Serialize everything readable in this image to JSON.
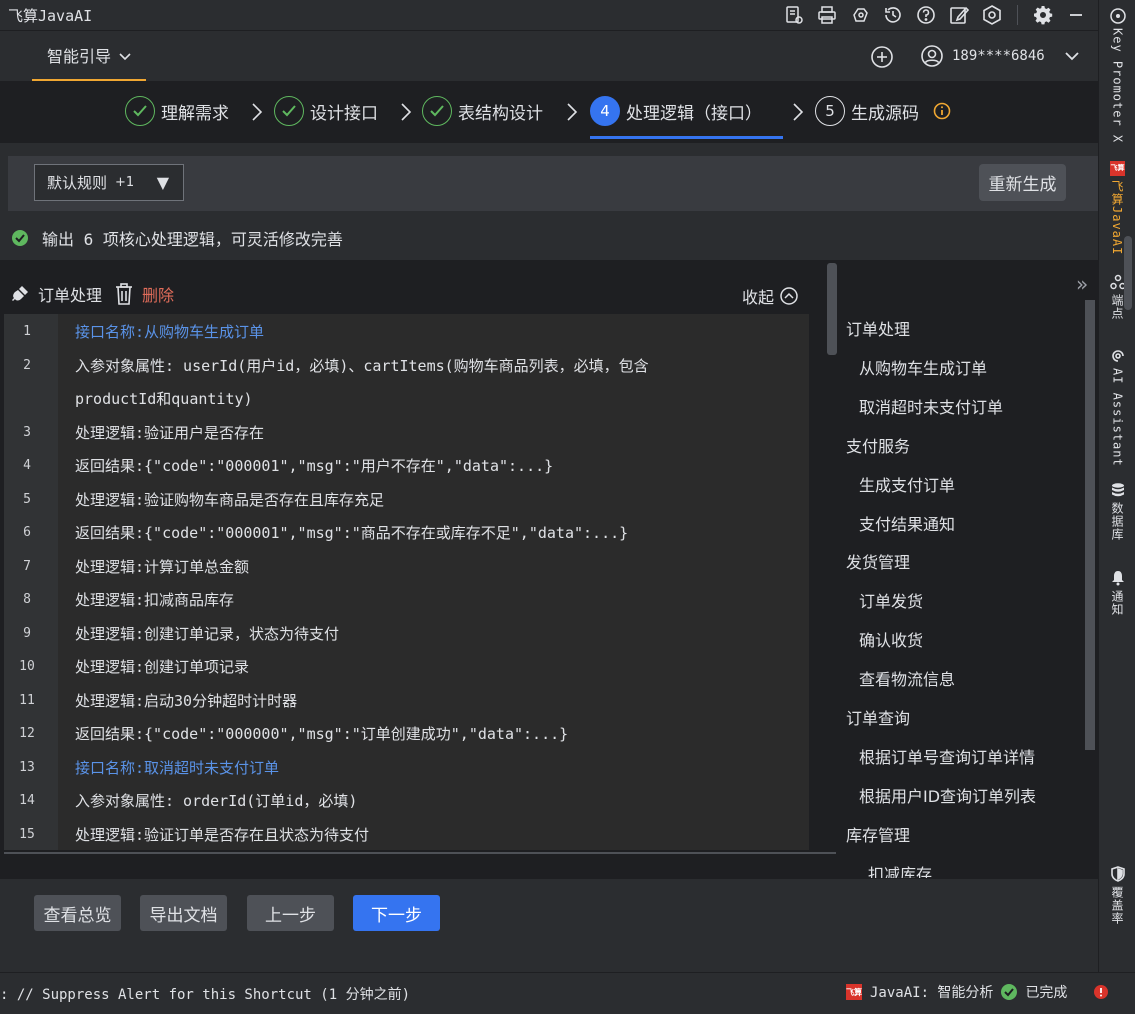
{
  "window": {
    "title": "飞算JavaAI"
  },
  "header": {
    "guide_tab": "智能引导",
    "user_phone": "189****6846"
  },
  "steps": [
    {
      "label": "理解需求",
      "num": "",
      "state": "done"
    },
    {
      "label": "设计接口",
      "num": "",
      "state": "done"
    },
    {
      "label": "表结构设计",
      "num": "",
      "state": "done"
    },
    {
      "label": "处理逻辑（接口）",
      "num": "4",
      "state": "current"
    },
    {
      "label": "生成源码",
      "num": "5",
      "state": "todo"
    }
  ],
  "toolbar": {
    "rule_select": "默认规则",
    "rule_count": "+1",
    "regen_label": "重新生成"
  },
  "status_msg": "输出 6 项核心处理逻辑，可灵活修改完善",
  "section": {
    "title": "订单处理",
    "delete_label": "删除",
    "collapse_label": "收起"
  },
  "editor": {
    "lines": [
      {
        "n": "1",
        "text": "接口名称:从购物车生成订单",
        "api": true
      },
      {
        "n": "2",
        "text": "入参对象属性: userId(用户id，必填)、cartItems(购物车商品列表，必填，包含",
        "api": false
      },
      {
        "n": "",
        "text": "productId和quantity)",
        "api": false
      },
      {
        "n": "3",
        "text": "处理逻辑:验证用户是否存在",
        "api": false
      },
      {
        "n": "4",
        "text": "返回结果:{\"code\":\"000001\",\"msg\":\"用户不存在\",\"data\":...}",
        "api": false
      },
      {
        "n": "5",
        "text": "处理逻辑:验证购物车商品是否存在且库存充足",
        "api": false
      },
      {
        "n": "6",
        "text": "返回结果:{\"code\":\"000001\",\"msg\":\"商品不存在或库存不足\",\"data\":...}",
        "api": false
      },
      {
        "n": "7",
        "text": "处理逻辑:计算订单总金额",
        "api": false
      },
      {
        "n": "8",
        "text": "处理逻辑:扣减商品库存",
        "api": false
      },
      {
        "n": "9",
        "text": "处理逻辑:创建订单记录，状态为待支付",
        "api": false
      },
      {
        "n": "10",
        "text": "处理逻辑:创建订单项记录",
        "api": false
      },
      {
        "n": "11",
        "text": "处理逻辑:启动30分钟超时计时器",
        "api": false
      },
      {
        "n": "12",
        "text": "返回结果:{\"code\":\"000000\",\"msg\":\"订单创建成功\",\"data\":...}",
        "api": false
      },
      {
        "n": "13",
        "text": "接口名称:取消超时未支付订单",
        "api": true
      },
      {
        "n": "14",
        "text": "入参对象属性: orderId(订单id，必填)",
        "api": false
      },
      {
        "n": "15",
        "text": "处理逻辑:验证订单是否存在且状态为待支付",
        "api": false
      }
    ]
  },
  "outline": [
    {
      "label": "订单处理",
      "level": 0
    },
    {
      "label": "从购物车生成订单",
      "level": 1
    },
    {
      "label": "取消超时未支付订单",
      "level": 1
    },
    {
      "label": "支付服务",
      "level": 0
    },
    {
      "label": "生成支付订单",
      "level": 1
    },
    {
      "label": "支付结果通知",
      "level": 1
    },
    {
      "label": "发货管理",
      "level": 0
    },
    {
      "label": "订单发货",
      "level": 1
    },
    {
      "label": "确认收货",
      "level": 1
    },
    {
      "label": "查看物流信息",
      "level": 1
    },
    {
      "label": "订单查询",
      "level": 0
    },
    {
      "label": "根据订单号查询订单详情",
      "level": 1
    },
    {
      "label": "根据用户ID查询订单列表",
      "level": 1
    },
    {
      "label": "库存管理",
      "level": 0
    },
    {
      "label": "扣减库存",
      "level": 2
    }
  ],
  "bottom": {
    "overview": "查看总览",
    "export": "导出文档",
    "prev": "上一步",
    "next": "下一步"
  },
  "right_strip": {
    "key_promoter": "Key Promoter X",
    "javaai": "飞算JavaAI",
    "endpoints": "端点",
    "ai_assistant": "AI Assistant",
    "database": "数据库",
    "notifications": "通知",
    "coverage": "覆盖率"
  },
  "statusbar": {
    "left_text": ": // Suppress Alert for this Shortcut (1 分钟之前)",
    "logo_text": "飞算",
    "analysis": "JavaAI: 智能分析",
    "done": "已完成"
  },
  "colors": {
    "accent": "#3574f0",
    "tab_underline": "#f0a732",
    "done_green": "#5fb85f",
    "danger": "#e06c5a",
    "api_blue": "#5a93e8"
  }
}
